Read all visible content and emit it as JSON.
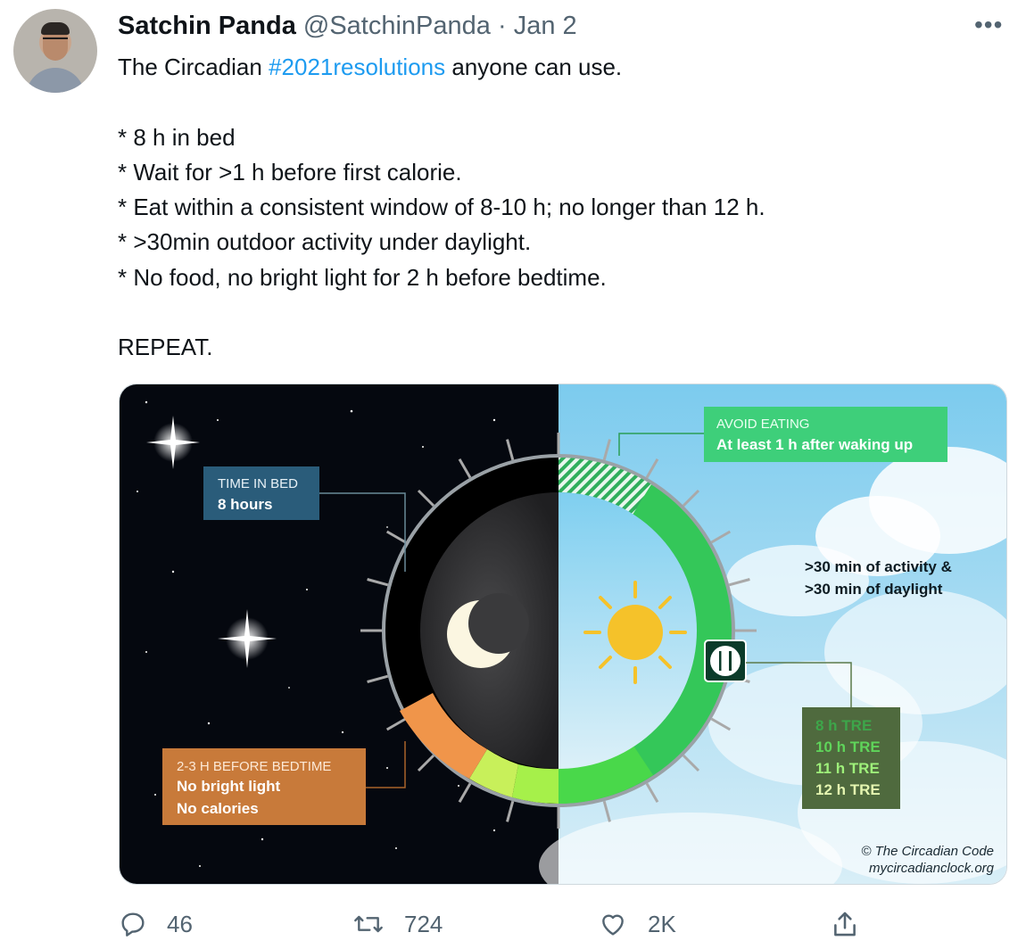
{
  "tweet": {
    "author_name": "Satchin Panda",
    "handle": "@SatchinPanda",
    "separator": "·",
    "date": "Jan 2",
    "more_label": "•••",
    "text_lead": "The Circadian ",
    "hashtag": "#2021resolutions",
    "text_trail": " anyone can use.",
    "bullets": [
      "* 8 h in bed",
      "* Wait for >1 h before first calorie.",
      "* Eat within a consistent window of 8-10 h; no longer than 12 h.",
      "* >30min outdoor activity under daylight.",
      "* No food, no bright light for 2 h before bedtime."
    ],
    "closing": "REPEAT."
  },
  "infographic": {
    "time_in_bed_title": "TIME IN BED",
    "time_in_bed_value": "8 hours",
    "avoid_eating_title": "AVOID EATING",
    "avoid_eating_value": "At least 1 h after waking up",
    "activity_line1": ">30 min of activity &",
    "activity_line2": ">30 min of daylight",
    "tre_options": [
      "8 h TRE",
      "10 h TRE",
      "11 h TRE",
      "12 h TRE"
    ],
    "bedtime_title": "2-3 H BEFORE BEDTIME",
    "bedtime_line1": "No bright light",
    "bedtime_line2": "No calories",
    "copyright": "© The Circadian Code",
    "website": "mycircadianclock.org",
    "colors": {
      "night": "#05080f",
      "sky": "#8dd0ef",
      "eating_ring": "#34c759",
      "bedtime_ring": "#f0954a",
      "time_in_bed_box": "#2a5c7a",
      "avoid_box": "#3ecf7a",
      "tre_box": "#4f6a3e",
      "bedtime_box": "#c87a3a"
    }
  },
  "actions": {
    "reply_count": "46",
    "retweet_count": "724",
    "like_count": "2K",
    "share_icon": "share-icon"
  }
}
